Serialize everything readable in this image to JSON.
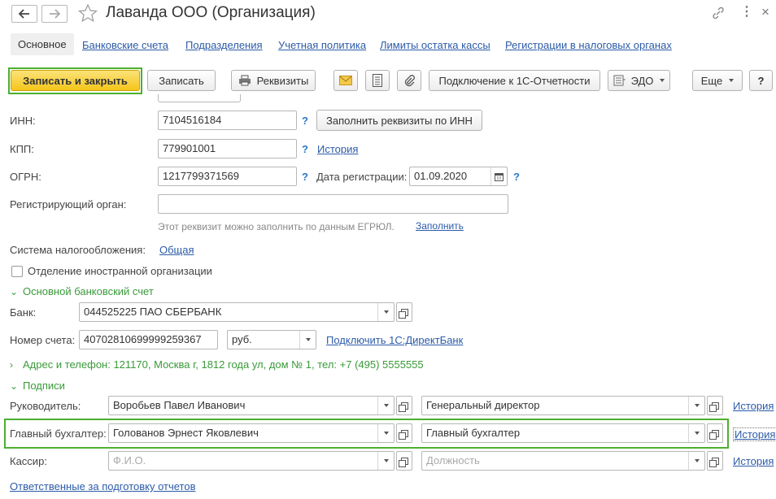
{
  "window": {
    "title": "Лаванда ООО (Организация)",
    "icons": [
      "arrow-left-icon",
      "arrow-right-icon",
      "star-icon",
      "link-icon",
      "more-vertical-icon",
      "close-icon"
    ]
  },
  "tabs": [
    {
      "label": "Основное",
      "active": true
    },
    {
      "label": "Банковские счета"
    },
    {
      "label": "Подразделения"
    },
    {
      "label": "Учетная политика"
    },
    {
      "label": "Лимиты остатка кассы"
    },
    {
      "label": "Регистрации в налоговых органах"
    }
  ],
  "toolbar": {
    "save_close": "Записать и закрыть",
    "save": "Записать",
    "requisites": "Реквизиты",
    "connect_reporting": "Подключение к 1С-Отчетности",
    "edo": "ЭДО",
    "more": "Еще",
    "help": "?"
  },
  "form": {
    "inn_label": "ИНН:",
    "inn_value": "7104516184",
    "fill_by_inn": "Заполнить реквизиты по ИНН",
    "kpp_label": "КПП:",
    "kpp_value": "779901001",
    "history": "История",
    "ogrn_label": "ОГРН:",
    "ogrn_value": "1217799371569",
    "reg_date_label": "Дата регистрации:",
    "reg_date_value": "01.09.2020",
    "reg_authority_label": "Регистрирующий орган:",
    "reg_authority_value": "",
    "egrul_hint": "Этот реквизит можно заполнить по данным ЕГРЮЛ.",
    "fill_link": "Заполнить",
    "tax_system_label": "Система налогообложения:",
    "tax_system_value": "Общая",
    "foreign_branch_label": "Отделение иностранной организации",
    "foreign_branch_checked": false,
    "q": "?"
  },
  "bank_section": {
    "title": "Основной банковский счет",
    "bank_label": "Банк:",
    "bank_value": "044525225 ПАО СБЕРБАНК",
    "account_label": "Номер счета:",
    "account_value": "40702810699999259367",
    "currency_value": "руб.",
    "direct_bank_link": "Подключить 1С:ДиректБанк"
  },
  "address_section": {
    "title": "Адрес и телефон: 121170, Москва г, 1812 года ул, дом № 1, тел: +7 (495) 5555555"
  },
  "signatures": {
    "title": "Подписи",
    "rows": [
      {
        "label": "Руководитель:",
        "name": "Воробьев Павел Иванович",
        "position": "Генеральный директор",
        "history": "История"
      },
      {
        "label": "Главный бухгалтер:",
        "name": "Голованов Эрнест Яковлевич",
        "position": "Главный бухгалтер",
        "history": "История"
      },
      {
        "label": "Кассир:",
        "name_placeholder": "Ф.И.О.",
        "position_placeholder": "Должность",
        "history": "История"
      }
    ],
    "responsible_link": "Ответственные за подготовку отчетов"
  },
  "colors": {
    "accent_green": "#4caf30",
    "primary_yellow": "#f5c51a",
    "link_blue": "#2c5ba8",
    "section_green": "#3a9a3a"
  }
}
